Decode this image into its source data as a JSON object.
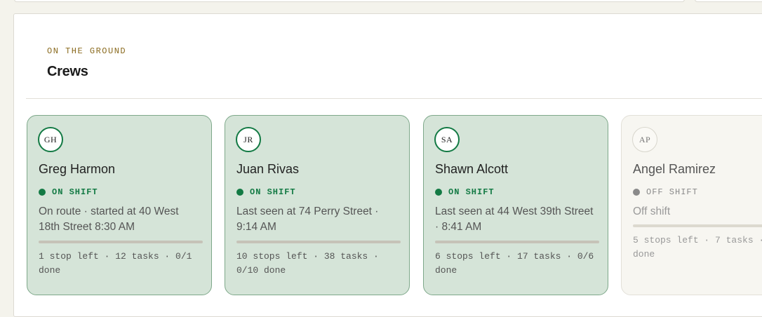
{
  "section": {
    "eyebrow": "ON THE GROUND",
    "title": "Crews"
  },
  "crews": [
    {
      "initials": "GH",
      "name": "Greg Harmon",
      "status": "ON SHIFT",
      "location": "On route · started at 40 West 18th Street 8:30 AM",
      "summary": "1 stop left · 12 tasks · 0/1 done",
      "progress": 0
    },
    {
      "initials": "JR",
      "name": "Juan Rivas",
      "status": "ON SHIFT",
      "location": "Last seen at 74 Perry Street · 9:14 AM",
      "summary": "10 stops left · 38 tasks · 0/10 done",
      "progress": 0
    },
    {
      "initials": "SA",
      "name": "Shawn Alcott",
      "status": "ON SHIFT",
      "location": "Last seen at 44 West 39th Street · 8:41 AM",
      "summary": "6 stops left · 17 tasks · 0/6 done",
      "progress": 0
    },
    {
      "initials": "AP",
      "name": "Angel Ramirez",
      "status": "OFF SHIFT",
      "location": "Off shift",
      "summary": "5 stops left · 7 tasks · done",
      "progress": 0
    }
  ],
  "colors": {
    "on_shift": "#137a44",
    "off_shift": "#8a8a8a",
    "card_on_bg": "#d5e4d8",
    "eyebrow": "#8a6a1e"
  }
}
